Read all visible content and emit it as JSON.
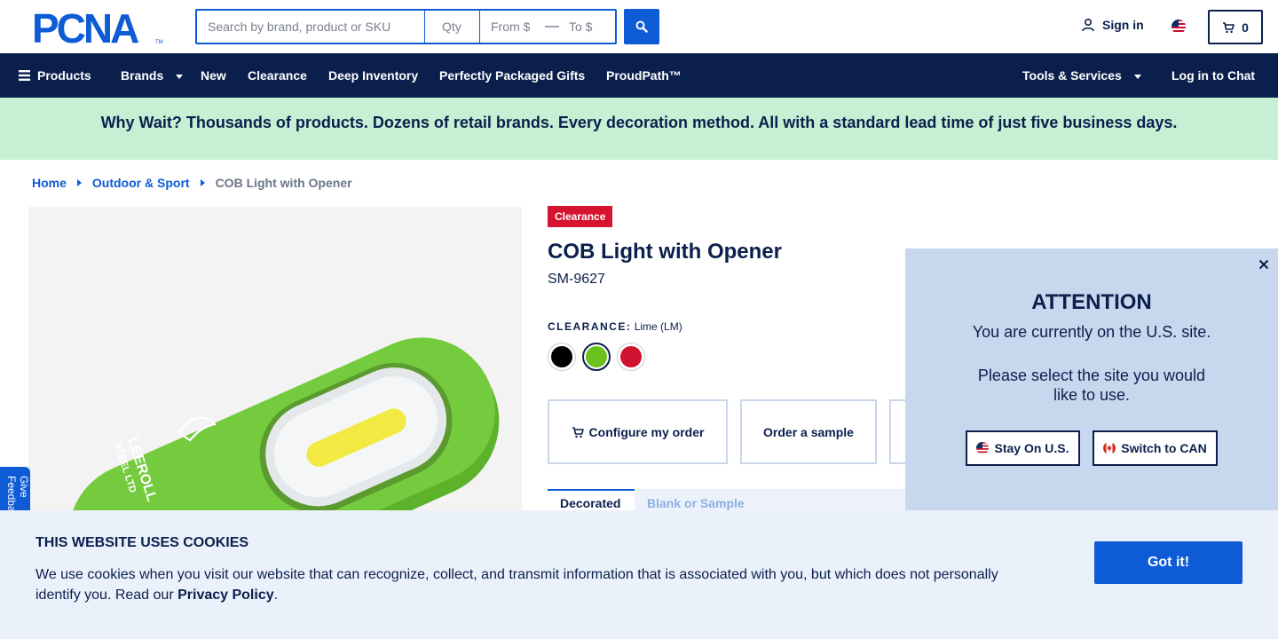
{
  "header": {
    "logo_text": "PCNA",
    "search": {
      "term_placeholder": "Search by brand, product or SKU",
      "qty_placeholder": "Qty",
      "from_placeholder": "From $",
      "to_placeholder": "To $",
      "dash": "—"
    },
    "sign_in": "Sign in",
    "cart_count": "0"
  },
  "nav": {
    "products": "Products",
    "brands": "Brands",
    "new": "New",
    "clearance": "Clearance",
    "deep_inventory": "Deep Inventory",
    "gifts": "Perfectly Packaged Gifts",
    "proudpath": "ProudPath™",
    "tools": "Tools & Services",
    "chat": "Log in to Chat"
  },
  "promo": "Why Wait? Thousands of products. Dozens of retail brands. Every decoration method. All with a standard lead time of just five business days.",
  "breadcrumb": [
    "Home",
    "Outdoor & Sport",
    "COB Light with Opener"
  ],
  "feedback_tab": "Give Feedback",
  "product": {
    "image_logo_line1": "LEEROLL",
    "image_logo_line2": "STEEL LTD",
    "badge": "Clearance",
    "title": "COB Light with Opener",
    "sku": "SM-9627",
    "color_label": "CLEARANCE:",
    "color_value": "Lime (LM)",
    "swatches": [
      {
        "name": "Black",
        "color": "#000000"
      },
      {
        "name": "Lime",
        "color": "#6cc11f"
      },
      {
        "name": "Red",
        "color": "#cf1230"
      }
    ],
    "configure_label": "Configure my order",
    "sample_label": "Order a sample",
    "tabs": [
      "Decorated",
      "Blank or Sample"
    ]
  },
  "locale_modal": {
    "heading": "ATTENTION",
    "line1": "You are currently on the U.S. site.",
    "line2": "Please select the site you would like to use.",
    "stay_label": "Stay On U.S.",
    "switch_label": "Switch to CAN"
  },
  "cookie": {
    "heading": "THIS WEBSITE USES COOKIES",
    "text_before": "We use cookies when you visit our website that can recognize, collect, and transmit information that is associated with you, but which does not personally identify you. Read our ",
    "link": "Privacy Policy",
    "text_after": ".",
    "button": "Got it!"
  },
  "colors": {
    "brand_navy": "#0b1f4d",
    "brand_blue": "#0e5bd6",
    "promo_green": "#c5f0d3",
    "clearance_red": "#d6142f",
    "modal_bg": "#c7d7ee",
    "cookie_bg": "#ebf1fb"
  }
}
